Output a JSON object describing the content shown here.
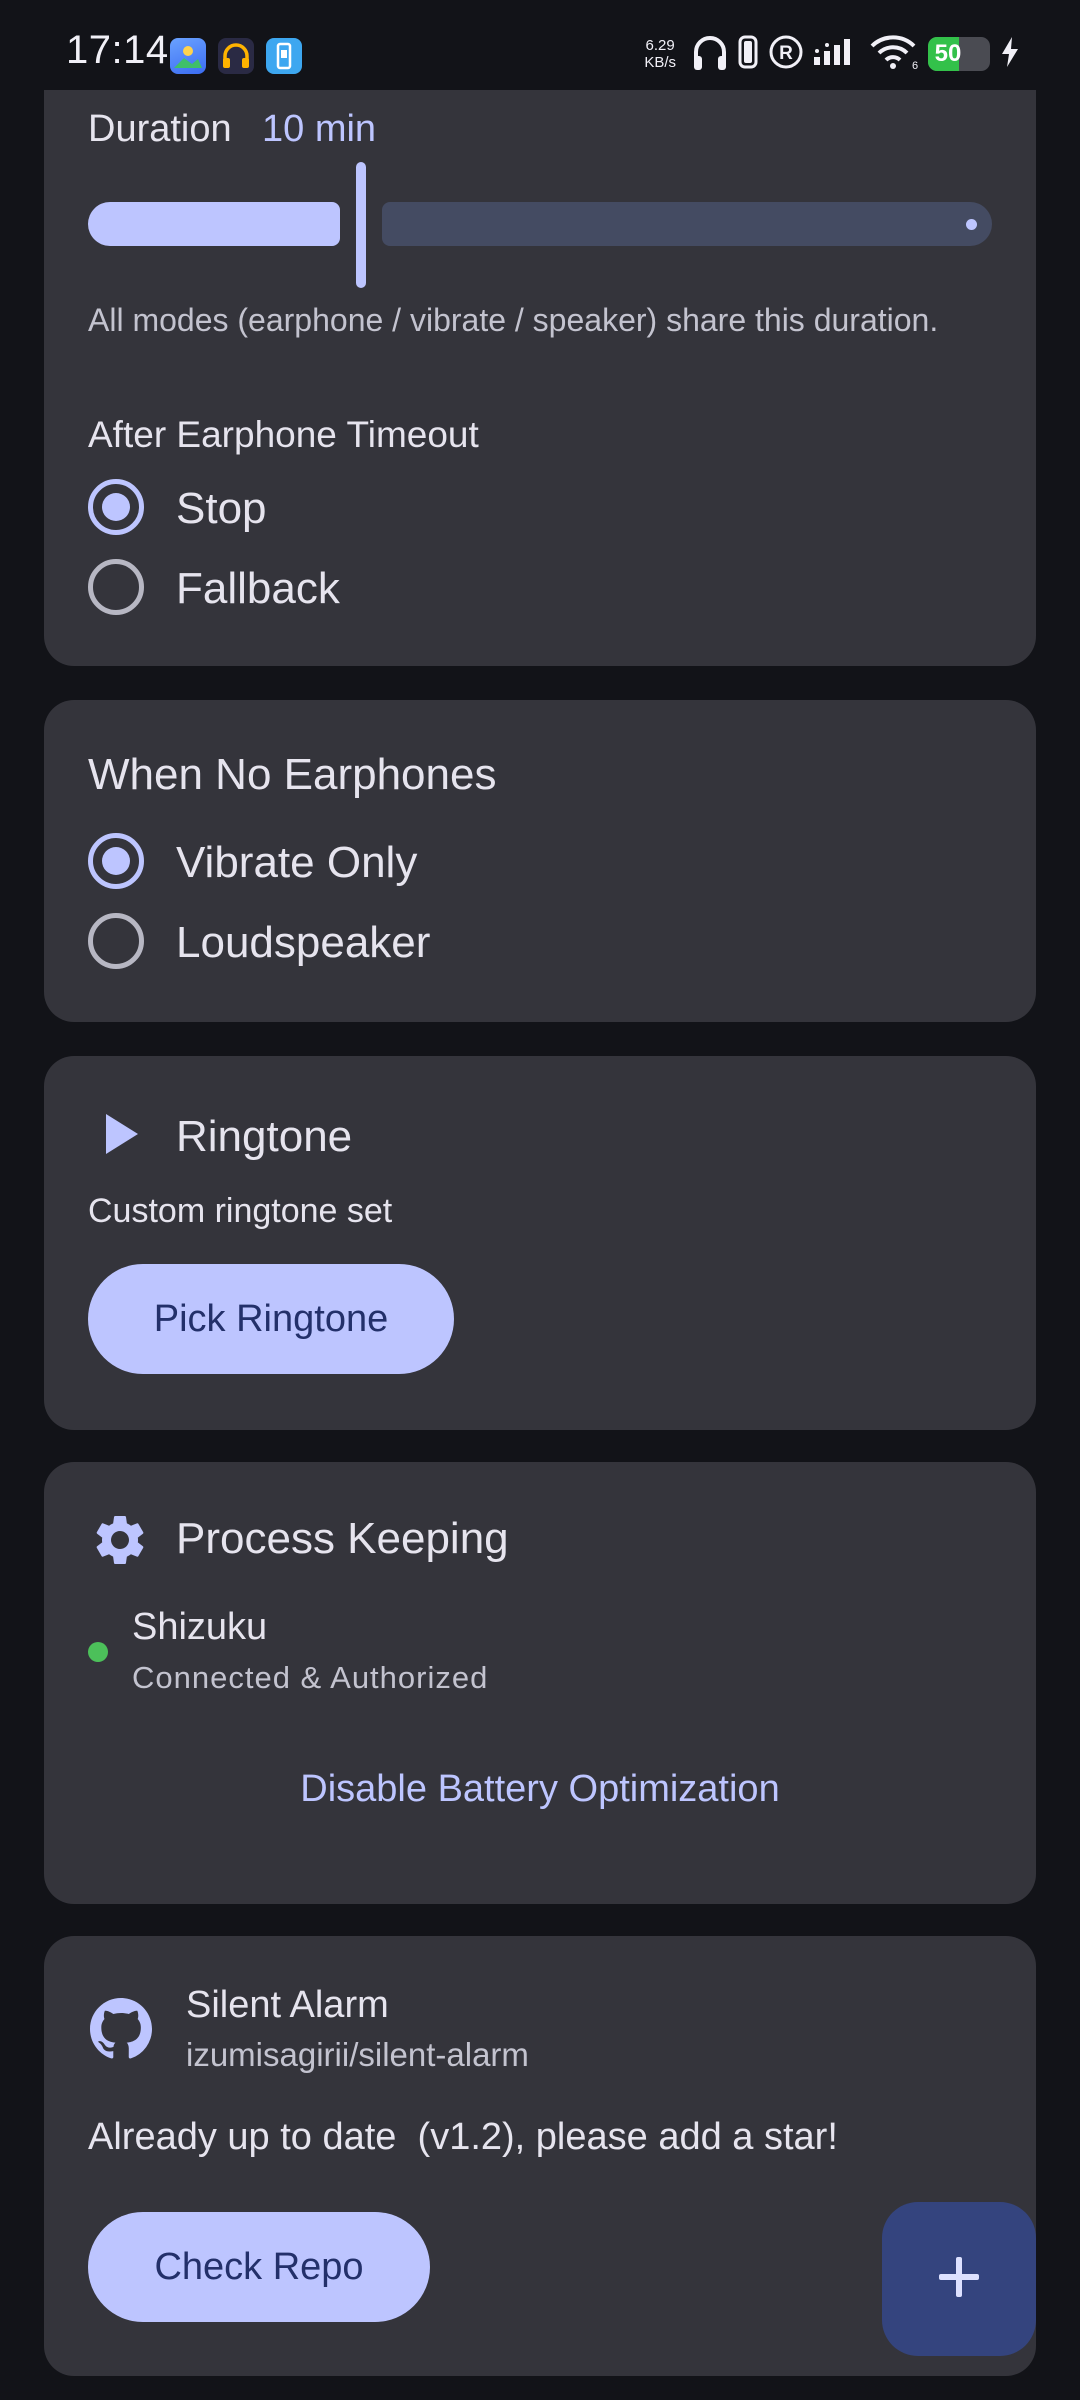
{
  "status_bar": {
    "time": "17:14",
    "net_speed_value": "6.29",
    "net_speed_unit": "KB/s",
    "battery_level": "50",
    "battery_percent": 50,
    "colors": {
      "battery": "#33c14a"
    }
  },
  "duration_card": {
    "label": "Duration",
    "value": "10 min",
    "slider_fraction": 0.3,
    "note": "All modes (earphone / vibrate / speaker) share this duration.",
    "after_timeout_label": "After Earphone Timeout",
    "options": [
      {
        "label": "Stop",
        "selected": true
      },
      {
        "label": "Fallback",
        "selected": false
      }
    ]
  },
  "no_earphones_card": {
    "title": "When No Earphones",
    "options": [
      {
        "label": "Vibrate Only",
        "selected": true
      },
      {
        "label": "Loudspeaker",
        "selected": false
      }
    ]
  },
  "ringtone_card": {
    "title": "Ringtone",
    "icon": "play-icon",
    "status": "Custom ringtone set",
    "button_label": "Pick Ringtone"
  },
  "process_card": {
    "title": "Process Keeping",
    "icon": "gear-icon",
    "service_name": "Shizuku",
    "service_status": "Connected & Authorized",
    "status_color": "#4cc05a",
    "button_label": "Disable Battery Optimization"
  },
  "repo_card": {
    "icon": "github-icon",
    "app_name": "Silent Alarm",
    "repo_path": "izumisagirii/silent-alarm",
    "message": "Already up to date  (v1.2), please add a star!",
    "button_label": "Check Repo"
  },
  "fab": {
    "icon": "plus-icon"
  },
  "colors": {
    "background": "#121318",
    "card": "#34343b",
    "accent": "#bdc5ff",
    "accent_text": "#23306a",
    "fab": "#34447e"
  }
}
